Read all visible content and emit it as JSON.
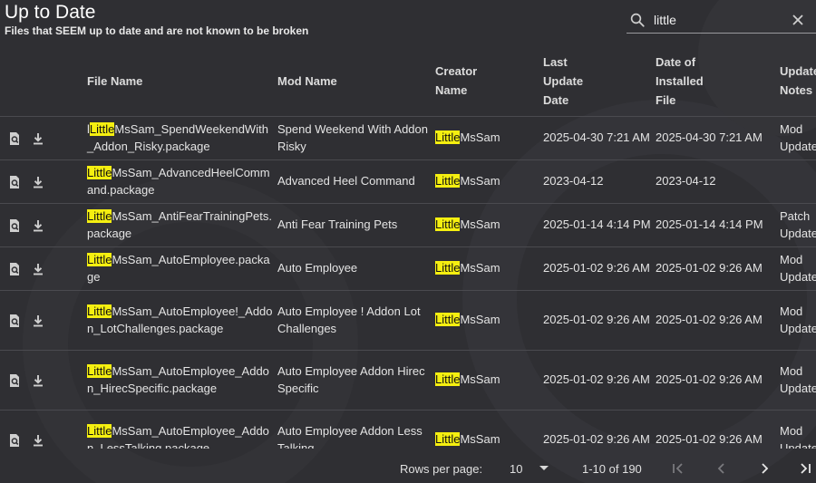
{
  "header": {
    "title": "Up to Date",
    "subtitle": "Files that SEEM up to date and are not known to be broken"
  },
  "search": {
    "value": "little",
    "icon": "search-icon",
    "clear_icon": "close-icon"
  },
  "columns": {
    "file_name": "File Name",
    "mod_name": "Mod Name",
    "creator_l1": "Creator",
    "creator_l2": "Name",
    "last_l1": "Last",
    "last_l2": "Update",
    "last_l3": "Date",
    "date_l1": "Date of",
    "date_l2": "Installed",
    "date_l3": "File",
    "notes_l1": "Update",
    "notes_l2": "Notes"
  },
  "rows": [
    {
      "file_pre": "l",
      "file_hl": "Little",
      "file_rest": "MsSam_SpendWeekendWith_Addon_Risky.package",
      "mod_name": "Spend Weekend With Addon Risky",
      "creator_hl": "Little",
      "creator_rest": "MsSam",
      "last_update": "2025-04-30 7:21 AM",
      "installed": "2025-04-30 7:21 AM",
      "notes": "Mod Update"
    },
    {
      "file_pre": "",
      "file_hl": "Little",
      "file_rest": "MsSam_AdvancedHeelCommand.package",
      "mod_name": "Advanced Heel Command",
      "creator_hl": "Little",
      "creator_rest": "MsSam",
      "last_update": "2023-04-12",
      "installed": "2023-04-12",
      "notes": ""
    },
    {
      "file_pre": "",
      "file_hl": "Little",
      "file_rest": "MsSam_AntiFearTrainingPets.package",
      "mod_name": "Anti Fear Training Pets",
      "creator_hl": "Little",
      "creator_rest": "MsSam",
      "last_update": "2025-01-14 4:14 PM",
      "installed": "2025-01-14 4:14 PM",
      "notes": "Patch Updates"
    },
    {
      "file_pre": "",
      "file_hl": "Little",
      "file_rest": "MsSam_AutoEmployee.package",
      "mod_name": "Auto Employee",
      "creator_hl": "Little",
      "creator_rest": "MsSam",
      "last_update": "2025-01-02 9:26 AM",
      "installed": "2025-01-02 9:26 AM",
      "notes": "Mod Update"
    },
    {
      "file_pre": "",
      "file_hl": "Little",
      "file_rest": "MsSam_AutoEmployee!_Addon_LotChallenges.package",
      "mod_name": "Auto Employee ! Addon Lot Challenges",
      "creator_hl": "Little",
      "creator_rest": "MsSam",
      "last_update": "2025-01-02 9:26 AM",
      "installed": "2025-01-02 9:26 AM",
      "notes": "Mod Update"
    },
    {
      "file_pre": "",
      "file_hl": "Little",
      "file_rest": "MsSam_AutoEmployee_Addon_HirecSpecific.package",
      "mod_name": "Auto Employee Addon Hirec Specific",
      "creator_hl": "Little",
      "creator_rest": "MsSam",
      "last_update": "2025-01-02 9:26 AM",
      "installed": "2025-01-02 9:26 AM",
      "notes": "Mod Update"
    },
    {
      "file_pre": "",
      "file_hl": "Little",
      "file_rest": "MsSam_AutoEmployee_Addon_LessTalking.package",
      "mod_name": "Auto Employee Addon Less Talking",
      "creator_hl": "Little",
      "creator_rest": "MsSam",
      "last_update": "2025-01-02 9:26 AM",
      "installed": "2025-01-02 9:26 AM",
      "notes": "Mod Update"
    }
  ],
  "row_icons": {
    "view": "file-search-icon",
    "download": "download-icon"
  },
  "footer": {
    "rows_per_page_label": "Rows per page:",
    "rows_per_page_value": "10",
    "range": "1-10 of 190"
  },
  "colors": {
    "background": "#2f2f33",
    "highlight": "#f5ef10",
    "divider": "#4a4a4f"
  }
}
